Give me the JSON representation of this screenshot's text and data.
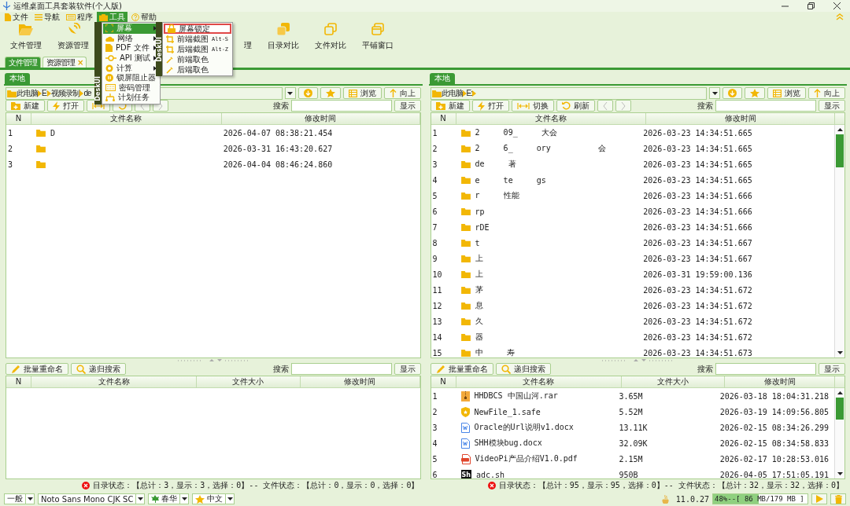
{
  "window": {
    "title": "运维桌面工具套装软件(个人版)"
  },
  "menu_bar": [
    {
      "label": "文件",
      "selected": false
    },
    {
      "label": "导航",
      "selected": false
    },
    {
      "label": "程序",
      "selected": false
    },
    {
      "label": "工具",
      "selected": true
    },
    {
      "label": "帮助",
      "selected": false
    }
  ],
  "tools_menu": {
    "brand": "DeskUI",
    "items": [
      {
        "label": "屏幕",
        "submenu": true,
        "selected": true
      },
      {
        "label": "网络",
        "submenu": true,
        "selected": false
      },
      {
        "label": "PDF 文件",
        "submenu": true,
        "selected": false
      },
      {
        "label": "API 测试",
        "submenu": true,
        "selected": false
      },
      {
        "label": "计算",
        "submenu": true,
        "selected": false
      },
      {
        "label": "锁屏阻止器",
        "submenu": false,
        "selected": false
      },
      {
        "label": "密码管理",
        "submenu": false,
        "selected": false
      },
      {
        "label": "计划任务",
        "submenu": false,
        "selected": false
      }
    ]
  },
  "screen_submenu": {
    "brand": "DeskUI",
    "items": [
      {
        "label": "屏幕锁定",
        "selected": true
      },
      {
        "label": "前端截图",
        "shortcut": "Alt-S",
        "selected": false
      },
      {
        "label": "后端截图",
        "shortcut": "Alt-Z",
        "selected": false
      },
      {
        "label": "前端取色",
        "selected": false
      },
      {
        "label": "后端取色",
        "selected": false
      }
    ]
  },
  "toolbar": [
    {
      "label": "文件管理",
      "kind": "tool"
    },
    {
      "label": "资源管理",
      "kind": "tool"
    },
    {
      "label": "理",
      "kind": "partial"
    },
    {
      "label": "目录对比",
      "kind": "tool"
    },
    {
      "label": "文件对比",
      "kind": "tool"
    },
    {
      "label": "平铺窗口",
      "kind": "tool"
    }
  ],
  "doc_tabs": [
    {
      "label": "文件管理",
      "selected": true
    },
    {
      "label": "资源管理",
      "selected": false,
      "close": "×"
    }
  ],
  "panes": [
    {
      "tab": {
        "label": "本地",
        "selected": true
      },
      "path": [
        "此电脑",
        "E:",
        "视频录制",
        "de"
      ],
      "path_trailing_chevron": false,
      "nav_buttons": [
        {
          "kind": "download"
        },
        {
          "kind": "star"
        },
        {
          "kind": "browse",
          "label": "浏览"
        },
        {
          "kind": "up",
          "label": "向上"
        }
      ],
      "actions": [
        {
          "kind": "new",
          "label": "新建"
        },
        {
          "kind": "open",
          "label": "打开"
        },
        {
          "kind": "switch"
        },
        {
          "kind": "refresh"
        },
        {
          "kind": "back"
        },
        {
          "kind": "forward"
        }
      ],
      "search": {
        "label": "搜索",
        "button": "显示"
      },
      "folders": {
        "columns": [
          "N",
          "文件名称",
          "修改时间"
        ],
        "scrollbar": false,
        "rows": [
          {
            "n": "1",
            "name": "D",
            "modified": "2026-04-07 08:38:21.454"
          },
          {
            "n": "2",
            "modified": "2026-03-31 16:43:20.627"
          },
          {
            "n": "3",
            "modified": "2026-04-04 08:46:24.860"
          }
        ]
      },
      "file_actions": [
        {
          "kind": "rename",
          "label": "批量重命名"
        },
        {
          "kind": "search",
          "label": "递归搜索"
        }
      ],
      "file_search": {
        "label": "搜索",
        "button": "显示"
      },
      "files": {
        "columns": [
          "N",
          "文件名称",
          "文件大小",
          "修改时间"
        ],
        "scrollbar": false
      },
      "status": "目录状态：【总计：3，显示：3，选择：0】-- 文件状态：【总计：0，显示：0，选择：0】"
    },
    {
      "tab": {
        "label": "本地",
        "selected": true
      },
      "path": [
        "此电脑",
        "E:"
      ],
      "path_trailing_chevron": true,
      "nav_buttons": [
        {
          "kind": "download"
        },
        {
          "kind": "star"
        },
        {
          "kind": "browse",
          "label": "浏览"
        },
        {
          "kind": "up",
          "label": "向上"
        }
      ],
      "actions": [
        {
          "kind": "new",
          "label": "新建"
        },
        {
          "kind": "open",
          "label": "打开"
        },
        {
          "kind": "switch",
          "label": "切换"
        },
        {
          "kind": "refresh",
          "label": "刷新"
        },
        {
          "kind": "back"
        },
        {
          "kind": "forward"
        }
      ],
      "search": {
        "label": "搜索",
        "button": "显示"
      },
      "folders": {
        "columns": [
          "N",
          "文件名称",
          "修改时间"
        ],
        "scrollbar": true,
        "rows": [
          {
            "n": "1",
            "name": "2     09_     大会",
            "modified": "2026-03-23 14:34:51.665"
          },
          {
            "n": "2",
            "name": "2     6_     ory          会",
            "modified": "2026-03-23 14:34:51.665"
          },
          {
            "n": "3",
            "name": "de     著",
            "modified": "2026-03-23 14:34:51.665"
          },
          {
            "n": "4",
            "name": "e     te     gs",
            "modified": "2026-03-23 14:34:51.665"
          },
          {
            "n": "5",
            "name": "r     性能",
            "modified": "2026-03-23 14:34:51.666"
          },
          {
            "n": "6",
            "name": "rp",
            "modified": "2026-03-23 14:34:51.666"
          },
          {
            "n": "7",
            "name": "rDE",
            "modified": "2026-03-23 14:34:51.666"
          },
          {
            "n": "8",
            "name": "t",
            "modified": "2026-03-23 14:34:51.667"
          },
          {
            "n": "9",
            "name": "上",
            "modified": "2026-03-23 14:34:51.667"
          },
          {
            "n": "10",
            "name": "上",
            "modified": "2026-03-31 19:59:00.136"
          },
          {
            "n": "11",
            "name": "茅",
            "modified": "2026-03-23 14:34:51.672"
          },
          {
            "n": "12",
            "name": "息",
            "modified": "2026-03-23 14:34:51.672"
          },
          {
            "n": "13",
            "name": "久",
            "modified": "2026-03-23 14:34:51.672"
          },
          {
            "n": "14",
            "name": "器",
            "modified": "2026-03-23 14:34:51.672"
          },
          {
            "n": "15",
            "name": "中     寿",
            "modified": "2026-03-23 14:34:51.673"
          }
        ]
      },
      "file_actions": [
        {
          "kind": "rename",
          "label": "批量重命名"
        },
        {
          "kind": "search",
          "label": "递归搜索"
        }
      ],
      "file_search": {
        "label": "搜索",
        "button": "显示"
      },
      "files": {
        "columns": [
          "N",
          "文件名称",
          "文件大小",
          "修改时间"
        ],
        "scrollbar": true,
        "rows": [
          {
            "n": "1",
            "kind": "archive",
            "name": "HHDBCS 中国山河.rar",
            "size": "3.65M",
            "modified": "2026-03-18 18:04:31.218"
          },
          {
            "n": "2",
            "kind": "shield",
            "name": "NewFile_1.safe",
            "size": "5.52M",
            "modified": "2026-03-19 14:09:56.805"
          },
          {
            "n": "3",
            "kind": "word",
            "name": "Oracle的Url说明v1.docx",
            "size": "13.11K",
            "modified": "2026-02-15 08:34:26.299"
          },
          {
            "n": "4",
            "kind": "word",
            "name": "SHH模块bug.docx",
            "size": "32.09K",
            "modified": "2026-02-15 08:34:58.833"
          },
          {
            "n": "5",
            "kind": "pdf",
            "name": "VideoPi产品介绍V1.0.pdf",
            "size": "2.15M",
            "modified": "2026-02-17 10:28:53.016"
          },
          {
            "n": "6",
            "kind": "shell",
            "icon_text": "Sh",
            "name": "adc.sh",
            "size": "950B",
            "modified": "2026-04-05 17:51:05.191"
          }
        ]
      },
      "status": "目录状态：【总计：95，显示：95，选择：0】-- 文件状态：【总计：32，显示：32，选择：0】"
    }
  ],
  "bottom_bar": {
    "selects": [
      {
        "value": "一般",
        "kind": "plain"
      },
      {
        "value": "Noto Sans Mono CJK SC",
        "kind": "plain"
      },
      {
        "value": "春华",
        "kind": "leaf"
      },
      {
        "value": "中文",
        "kind": "star"
      }
    ],
    "version": "11.0.27",
    "memory": {
      "text": "48%--[ 86 MB/179 MB ]",
      "level": 0.48
    }
  }
}
